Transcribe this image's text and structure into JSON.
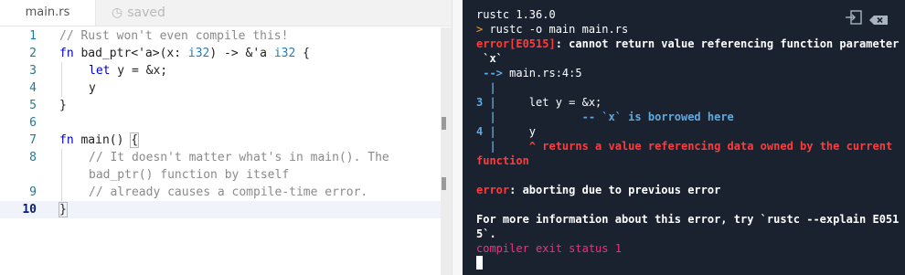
{
  "editor": {
    "tab_label": "main.rs",
    "saved_label": "saved",
    "saved_icon": "clock-icon",
    "lines": [
      {
        "num": "1",
        "parts": [
          {
            "t": "// Rust won't even compile this!",
            "c": "cm"
          }
        ]
      },
      {
        "num": "2",
        "parts": [
          {
            "t": "fn",
            "c": "kw"
          },
          {
            "t": " bad_ptr<'a>(x: ",
            "c": ""
          },
          {
            "t": "i32",
            "c": "ty"
          },
          {
            "t": ") -> &'a ",
            "c": ""
          },
          {
            "t": "i32",
            "c": "ty"
          },
          {
            "t": " {",
            "c": ""
          }
        ]
      },
      {
        "num": "3",
        "indent": 1,
        "parts": [
          {
            "t": "let",
            "c": "kw"
          },
          {
            "t": " y = &x;",
            "c": ""
          }
        ]
      },
      {
        "num": "4",
        "indent": 1,
        "parts": [
          {
            "t": "y",
            "c": ""
          }
        ]
      },
      {
        "num": "5",
        "parts": [
          {
            "t": "}",
            "c": ""
          }
        ]
      },
      {
        "num": "6",
        "parts": []
      },
      {
        "num": "7",
        "parts": [
          {
            "t": "fn",
            "c": "kw"
          },
          {
            "t": " main() ",
            "c": ""
          },
          {
            "t": "{",
            "c": "brace"
          }
        ]
      },
      {
        "num": "8",
        "indent": 1,
        "parts": [
          {
            "t": "// It doesn't matter what's in main(). The",
            "c": "cm"
          }
        ]
      },
      {
        "num": "",
        "indent": 1,
        "parts": [
          {
            "t": "bad_ptr() function by itself",
            "c": "cm"
          }
        ]
      },
      {
        "num": "9",
        "indent": 1,
        "parts": [
          {
            "t": "// already causes a compile-time error.",
            "c": "cm"
          }
        ]
      },
      {
        "num": "10",
        "active": true,
        "parts": [
          {
            "t": "}",
            "c": "brace"
          }
        ]
      }
    ]
  },
  "terminal": {
    "title": "rustc 1.36.0",
    "icons": [
      "exit-icon",
      "clear-icon"
    ],
    "lines": [
      {
        "parts": [
          {
            "t": "> ",
            "c": "orange"
          },
          {
            "t": "rustc -o main main.rs",
            "c": ""
          }
        ]
      },
      {
        "parts": [
          {
            "t": "error[E0515]",
            "c": "red b"
          },
          {
            "t": ": cannot return value referencing function parameter",
            "c": "b"
          }
        ]
      },
      {
        "parts": [
          {
            "t": " `x`",
            "c": "b"
          }
        ]
      },
      {
        "parts": [
          {
            "t": " --> ",
            "c": "cyan b"
          },
          {
            "t": "main.rs:4:5",
            "c": ""
          }
        ]
      },
      {
        "parts": [
          {
            "t": "  |",
            "c": "cyan b"
          }
        ]
      },
      {
        "parts": [
          {
            "t": "3 |",
            "c": "cyan b"
          },
          {
            "t": "     let y = &x;",
            "c": ""
          }
        ]
      },
      {
        "parts": [
          {
            "t": "  |",
            "c": "cyan b"
          },
          {
            "t": "             -- `x` is borrowed here",
            "c": "cyan b"
          }
        ]
      },
      {
        "parts": [
          {
            "t": "4 |",
            "c": "cyan b"
          },
          {
            "t": "     y",
            "c": ""
          }
        ]
      },
      {
        "parts": [
          {
            "t": "  |",
            "c": "cyan b"
          },
          {
            "t": "     ^ returns a value referencing data owned by the current",
            "c": "red b"
          }
        ]
      },
      {
        "parts": [
          {
            "t": "function",
            "c": "red b"
          }
        ]
      },
      {
        "parts": []
      },
      {
        "parts": [
          {
            "t": "error",
            "c": "red b"
          },
          {
            "t": ": aborting due to previous error",
            "c": "b"
          }
        ]
      },
      {
        "parts": []
      },
      {
        "parts": [
          {
            "t": "For more information about this error, try `rustc --explain E051",
            "c": "b"
          }
        ]
      },
      {
        "parts": [
          {
            "t": "5`.",
            "c": "b"
          }
        ]
      },
      {
        "parts": [
          {
            "t": "compiler exit status 1",
            "c": "pink"
          }
        ]
      }
    ]
  }
}
